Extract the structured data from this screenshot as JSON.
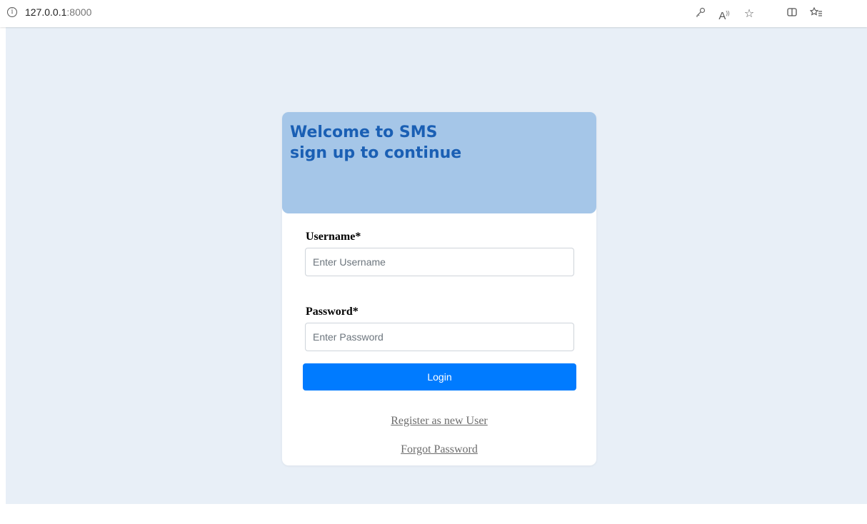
{
  "browser": {
    "url_host": "127.0.0.1",
    "url_port": ":8000",
    "toolbar_icons": [
      "key-icon",
      "read-aloud-icon",
      "favorite-star-icon",
      "split-screen-icon",
      "favorites-list-icon"
    ]
  },
  "colors": {
    "page_background": "#e8eff7",
    "header_background": "#a5c6e8",
    "heading_text": "#1a5fb4",
    "login_button": "#007bff",
    "link_text": "#6c6c6c"
  },
  "header": {
    "line1": "Welcome to SMS",
    "line2": "sign up to continue"
  },
  "form": {
    "username_label": "Username*",
    "username_placeholder": "Enter Username",
    "username_value": "",
    "password_label": "Password*",
    "password_placeholder": "Enter Password",
    "password_value": "",
    "login_label": "Login"
  },
  "links": {
    "register": "Register as new User",
    "forgot_password": "Forgot Password"
  }
}
